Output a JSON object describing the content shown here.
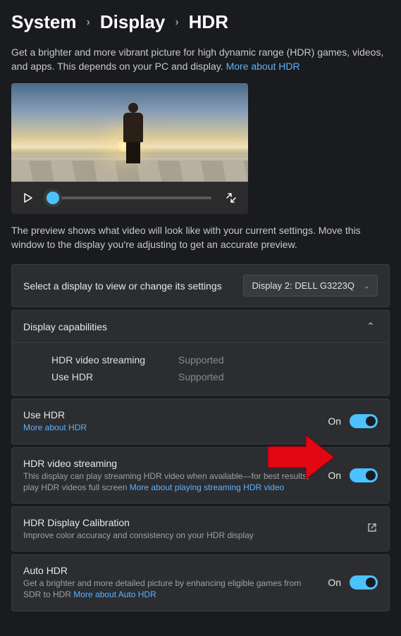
{
  "breadcrumb": {
    "level1": "System",
    "level2": "Display",
    "level3": "HDR"
  },
  "intro": {
    "text": "Get a brighter and more vibrant picture for high dynamic range (HDR) games, videos, and apps. This depends on your PC and display. ",
    "link": "More about HDR"
  },
  "preview_caption": "The preview shows what video will look like with your current settings. Move this window to the display you're adjusting to get an accurate preview.",
  "select_display": {
    "label": "Select a display to view or change its settings",
    "value": "Display 2: DELL G3223Q"
  },
  "capabilities": {
    "header": "Display capabilities",
    "rows": [
      {
        "label": "HDR video streaming",
        "value": "Supported"
      },
      {
        "label": "Use HDR",
        "value": "Supported"
      }
    ]
  },
  "use_hdr": {
    "title": "Use HDR",
    "link": "More about HDR",
    "state": "On"
  },
  "hdr_streaming": {
    "title": "HDR video streaming",
    "sub": "This display can play streaming HDR video when available—for best results, play HDR videos full screen  ",
    "link": "More about playing streaming HDR video",
    "state": "On"
  },
  "hdr_calibration": {
    "title": "HDR Display Calibration",
    "sub": "Improve color accuracy and consistency on your HDR display"
  },
  "auto_hdr": {
    "title": "Auto HDR",
    "sub": "Get a brighter and more detailed picture by enhancing eligible games from SDR to HDR  ",
    "link": "More about Auto HDR",
    "state": "On"
  }
}
